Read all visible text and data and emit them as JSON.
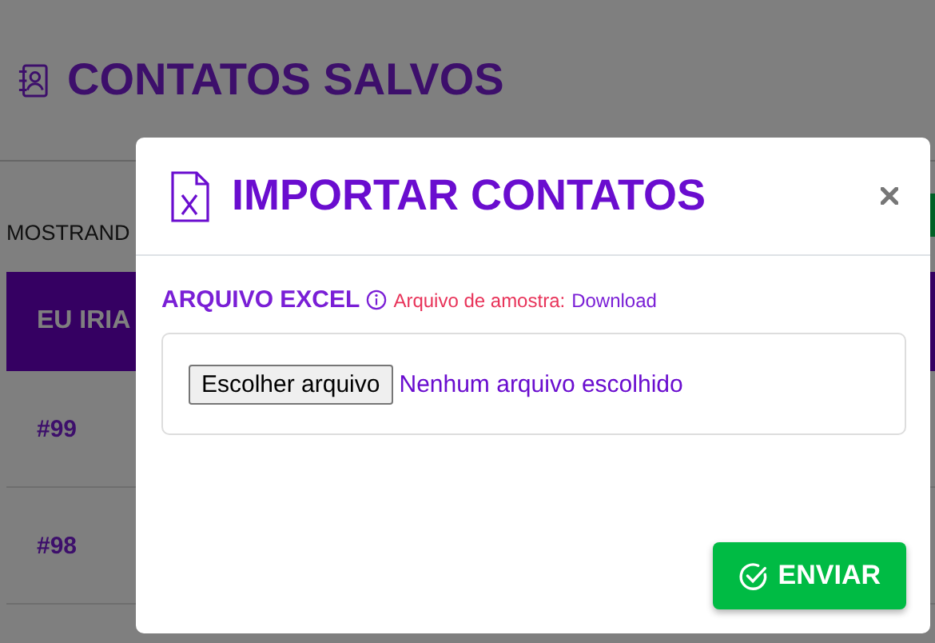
{
  "page": {
    "title": "CONTATOS SALVOS",
    "showing_text": "MOSTRAND",
    "table": {
      "columns": [
        "EU IRIA"
      ],
      "rows": [
        [
          "#99"
        ],
        [
          "#98"
        ]
      ]
    }
  },
  "modal": {
    "title": "IMPORTAR CONTATOS",
    "field_label": "ARQUIVO EXCEL",
    "sample_text": "Arquivo de amostra:",
    "sample_link": "Download",
    "file_button": "Escolher arquivo",
    "file_status": "Nenhum arquivo escolhido",
    "submit": "ENVIAR"
  }
}
